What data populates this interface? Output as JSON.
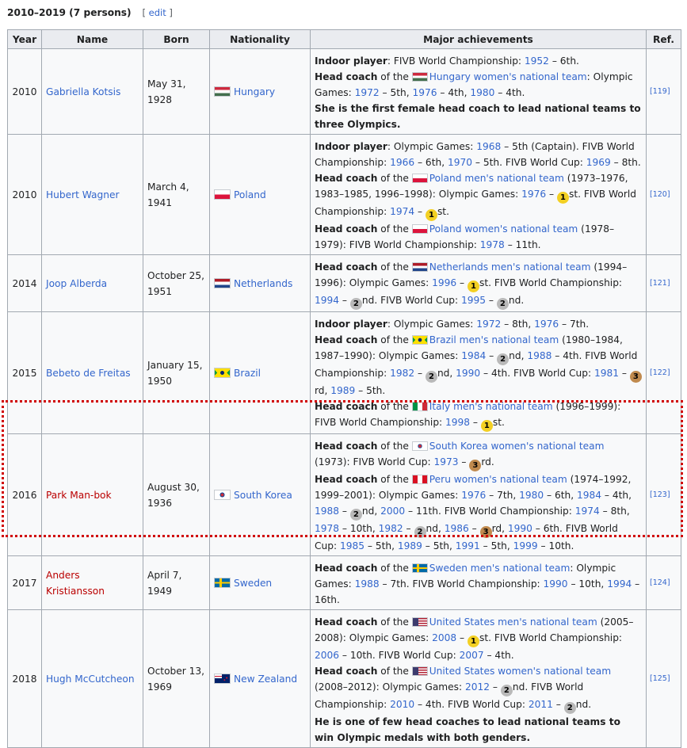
{
  "section": {
    "title": "2010–2019 (7 persons)",
    "edit_open": "[",
    "edit_label": "edit",
    "edit_close": "]"
  },
  "columns": [
    "Year",
    "Name",
    "Born",
    "Nationality",
    "Major achievements",
    "Ref."
  ],
  "rows": [
    {
      "year": "2010",
      "name": "Gabriella Kotsis",
      "born": [
        "May 31,",
        "1928"
      ],
      "nationality": "Hungary",
      "flag": "hungary-flag",
      "ref": "[119]",
      "achievements": [
        [
          "Indoor player",
          ": FIVB World Championship: ",
          "1952",
          " – 6th."
        ],
        [
          "Head coach",
          " of the ",
          "Hungary women's national team",
          ": Olympic Games: ",
          "1972",
          " – 5th, ",
          "1976",
          " – 4th, ",
          "1980",
          " – 4th."
        ],
        [
          "She is the first female head coach to lead national teams to three Olympics."
        ]
      ]
    },
    {
      "year": "2010",
      "name": "Hubert Wagner",
      "born": [
        "March 4,",
        "1941"
      ],
      "nationality": "Poland",
      "flag": "poland-flag",
      "ref": "[120]",
      "achievements": [
        [
          "Indoor player",
          ": Olympic Games: ",
          "1968",
          " – 5th (Captain). FIVB World Championship: ",
          "1966",
          " – 6th, ",
          "1970",
          " – 5th. FIVB World Cup: ",
          "1969",
          " – 8th."
        ],
        [
          "Head coach",
          " of the ",
          "Poland men's national team",
          " (1973–1976, 1983–1985, 1996–1998): Olympic Games: ",
          "1976",
          " – ",
          "1",
          "st. FIVB World Championship: ",
          "1974",
          " – ",
          "1",
          "st."
        ],
        [
          "Head coach",
          " of the ",
          "Poland women's national team",
          " (1978–1979): FIVB World Championship: ",
          "1978",
          " – 11th."
        ]
      ]
    },
    {
      "year": "2014",
      "name": "Joop Alberda",
      "born": [
        "October 25,",
        "1951"
      ],
      "nationality": "Netherlands",
      "flag": "netherlands-flag",
      "ref": "[121]",
      "achievements": [
        [
          "Head coach",
          " of the ",
          "Netherlands men's national team",
          " (1994–1996): Olympic Games: ",
          "1996",
          " – ",
          "1",
          "st. FIVB World Championship: ",
          "1994",
          " – ",
          "2",
          "nd. FIVB World Cup: ",
          "1995",
          " – ",
          "2",
          "nd."
        ]
      ]
    },
    {
      "year": "2015",
      "name": "Bebeto de Freitas",
      "born": [
        "January 15,",
        "1950"
      ],
      "nationality": "Brazil",
      "flag": "brazil-flag",
      "ref": "[122]",
      "achievements": [
        [
          "Indoor player",
          ": Olympic Games: ",
          "1972",
          " – 8th, ",
          "1976",
          " – 7th."
        ],
        [
          "Head coach",
          " of the ",
          "Brazil men's national team",
          " (1980–1984, 1987–1990): Olympic Games: ",
          "1984",
          " – ",
          "2",
          "nd, ",
          "1988",
          " – 4th. FIVB World Championship: ",
          "1982",
          " – ",
          "2",
          "nd, ",
          "1990",
          " – 4th. FIVB World Cup: ",
          "1981",
          " – ",
          "3",
          "rd, ",
          "1989",
          " – 5th."
        ],
        [
          "Head coach",
          " of the ",
          "Italy men's national team",
          " (1996–1999): FIVB World Championship: ",
          "1998",
          " – ",
          "1",
          "st."
        ]
      ]
    },
    {
      "year": "2016",
      "name": "Park Man-bok",
      "born": [
        "August 30,",
        "1936"
      ],
      "nationality": "South Korea",
      "flag": "south-korea-flag",
      "ref": "[123]",
      "achievements": [
        [
          "Head coach",
          " of the ",
          "South Korea women's national team",
          " (1973): FIVB World Cup: ",
          "1973",
          " – ",
          "3",
          "rd."
        ],
        [
          "Head coach",
          " of the ",
          "Peru women's national team",
          " (1974–1992, 1999–2001): Olympic Games: ",
          "1976",
          " – 7th, ",
          "1980",
          " – 6th, ",
          "1984",
          " – 4th, ",
          "1988",
          " – ",
          "2",
          "nd, ",
          "2000",
          " – 11th. FIVB World Championship: ",
          "1974",
          " – 8th, ",
          "1978",
          " – 10th, ",
          "1982",
          " – ",
          "2",
          "nd, ",
          "1986",
          " – ",
          "3",
          "rd, ",
          "1990",
          " – 6th. FIVB World Cup: ",
          "1985",
          " – 5th, ",
          "1989",
          " – 5th, ",
          "1991",
          " – 5th, ",
          "1999",
          " – 10th."
        ]
      ]
    },
    {
      "year": "2017",
      "name": "Anders Kristiansson",
      "born": [
        "April 7, 1949"
      ],
      "nationality": "Sweden",
      "flag": "sweden-flag",
      "ref": "[124]",
      "achievements": [
        [
          "Head coach",
          " of the ",
          "Sweden men's national team",
          ": Olympic Games: ",
          "1988",
          " – 7th. FIVB World Championship: ",
          "1990",
          " – 10th, ",
          "1994",
          " – 16th."
        ]
      ]
    },
    {
      "year": "2018",
      "name": "Hugh McCutcheon",
      "born": [
        "October 13,",
        "1969"
      ],
      "nationality": "New Zealand",
      "flag": "new-zealand-flag",
      "ref": "[125]",
      "achievements": [
        [
          "Head coach",
          " of the ",
          "United States men's national team",
          " (2005–2008): Olympic Games: ",
          "2008",
          " – ",
          "1",
          "st. FIVB World Championship: ",
          "2006",
          " – 10th. FIVB World Cup: ",
          "2007",
          " – 4th."
        ],
        [
          "Head coach",
          " of the ",
          "United States women's national team",
          " (2008–2012): Olympic Games: ",
          "2012",
          " – ",
          "2",
          "nd. FIVB World Championship: ",
          "2010",
          " – 4th. FIVB World Cup: ",
          "2011",
          " – ",
          "2",
          "nd."
        ],
        [
          "He is one of few head coaches to lead national teams to win Olympic medals with both genders."
        ]
      ]
    }
  ]
}
